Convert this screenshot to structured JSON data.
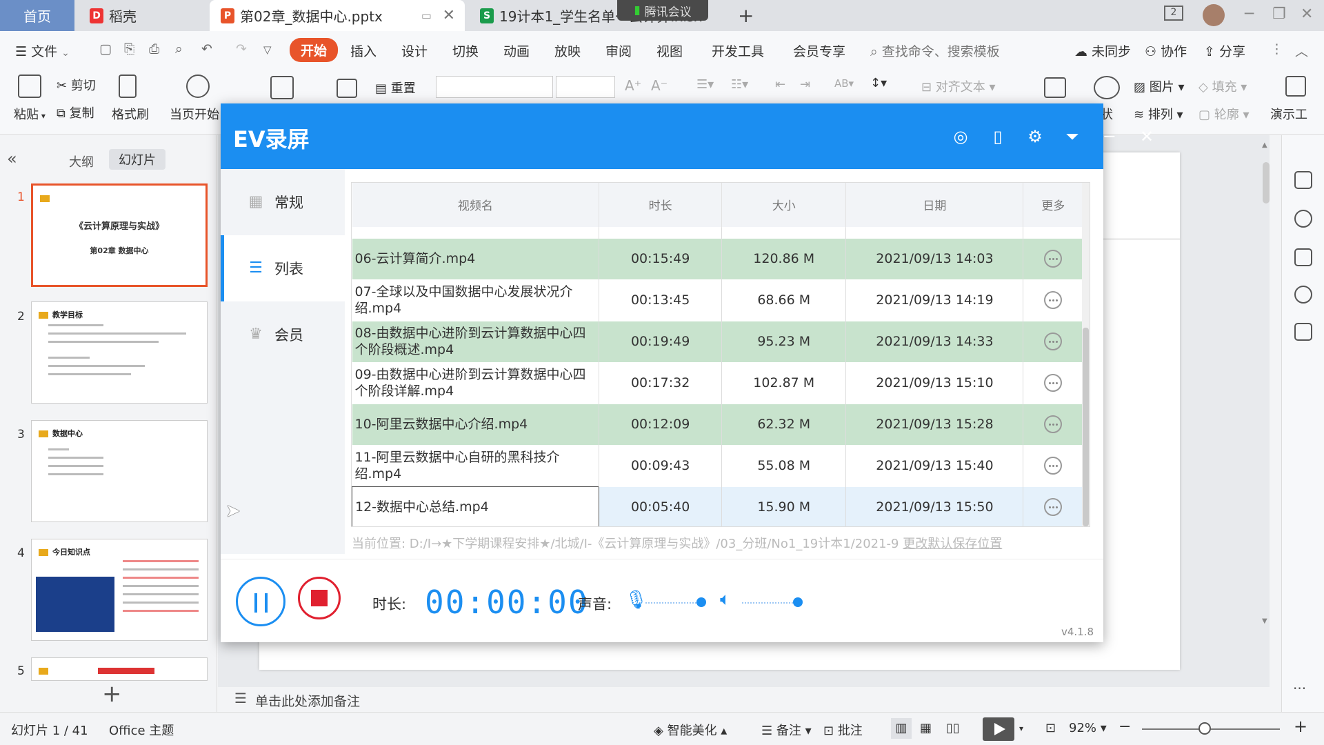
{
  "titlebar": {
    "tab_home": "首页",
    "tab_daoke": "稻壳",
    "tab_pptx": "第02章_数据中心.pptx",
    "tab_xlsx": "19计本1_学生名单一云计算.xlsx",
    "meeting_badge": "腾讯会议",
    "new_tab": "+",
    "win_page": "2"
  },
  "menubar": {
    "file": "文件",
    "start": "开始",
    "insert": "插入",
    "design": "设计",
    "switch": "切换",
    "animation": "动画",
    "slideshow": "放映",
    "review": "审阅",
    "view": "视图",
    "devtools": "开发工具",
    "vip": "会员专享",
    "search": "查找命令、搜索模板",
    "sync": "未同步",
    "collab": "协作",
    "share": "分享"
  },
  "ribbon": {
    "paste": "粘贴",
    "cut": "剪切",
    "copy": "复制",
    "format_painter": "格式刷",
    "from_current": "当页开始",
    "reset": "重置",
    "align_text": "对齐文本",
    "picture": "图片",
    "fill": "填充",
    "arrange": "排列",
    "outline": "轮廓",
    "shape": "状",
    "present": "演示工"
  },
  "left_panel": {
    "outline_tab": "大纲",
    "slides_tab": "幻灯片",
    "slides": [
      {
        "num": "1",
        "title": "《云计算原理与实战》",
        "subtitle": "第02章 数据中心"
      },
      {
        "num": "2",
        "title": "教学目标"
      },
      {
        "num": "3",
        "title": "数据中心"
      },
      {
        "num": "4",
        "title": "今日知识点"
      },
      {
        "num": "5",
        "title": ""
      }
    ]
  },
  "notes_placeholder": "单击此处添加备注",
  "statusbar": {
    "slide_count": "幻灯片 1 / 41",
    "theme": "Office 主题",
    "beautify": "智能美化",
    "notes": "备注",
    "comments": "批注",
    "zoom": "92%"
  },
  "ev": {
    "title": "EV录屏",
    "sidebar": [
      "常规",
      "列表",
      "会员"
    ],
    "columns": [
      "视频名",
      "时长",
      "大小",
      "日期",
      "更多"
    ],
    "rows": [
      {
        "name": "06-云计算简介.mp4",
        "duration": "00:15:49",
        "size": "120.86 M",
        "date": "2021/09/13 14:03"
      },
      {
        "name": "07-全球以及中国数据中心发展状况介绍.mp4",
        "duration": "00:13:45",
        "size": "68.66 M",
        "date": "2021/09/13 14:19"
      },
      {
        "name": "08-由数据中心进阶到云计算数据中心四个阶段概述.mp4",
        "duration": "00:19:49",
        "size": "95.23 M",
        "date": "2021/09/13 14:33"
      },
      {
        "name": "09-由数据中心进阶到云计算数据中心四个阶段详解.mp4",
        "duration": "00:17:32",
        "size": "102.87 M",
        "date": "2021/09/13 15:10"
      },
      {
        "name": "10-阿里云数据中心介绍.mp4",
        "duration": "00:12:09",
        "size": "62.32 M",
        "date": "2021/09/13 15:28"
      },
      {
        "name": "11-阿里云数据中心自研的黑科技介绍.mp4",
        "duration": "00:09:43",
        "size": "55.08 M",
        "date": "2021/09/13 15:40"
      },
      {
        "name": "12-数据中心总结.mp4",
        "duration": "00:05:40",
        "size": "15.90 M",
        "date": "2021/09/13 15:50"
      }
    ],
    "save_path": "当前位置: D:/Ⅰ→★下学期课程安排★/北城/Ⅰ-《云计算原理与实战》/03_分班/No1_19计本1/2021-9",
    "change_save": "更改默认保存位置",
    "duration_label": "时长:",
    "timer": "00:00:00",
    "sound_label": "声音:",
    "version": "v4.1.8",
    "colors": {
      "header": "#1b8ef1",
      "row_highlight": "#c8e3cd",
      "stop": "#e0202f"
    }
  }
}
